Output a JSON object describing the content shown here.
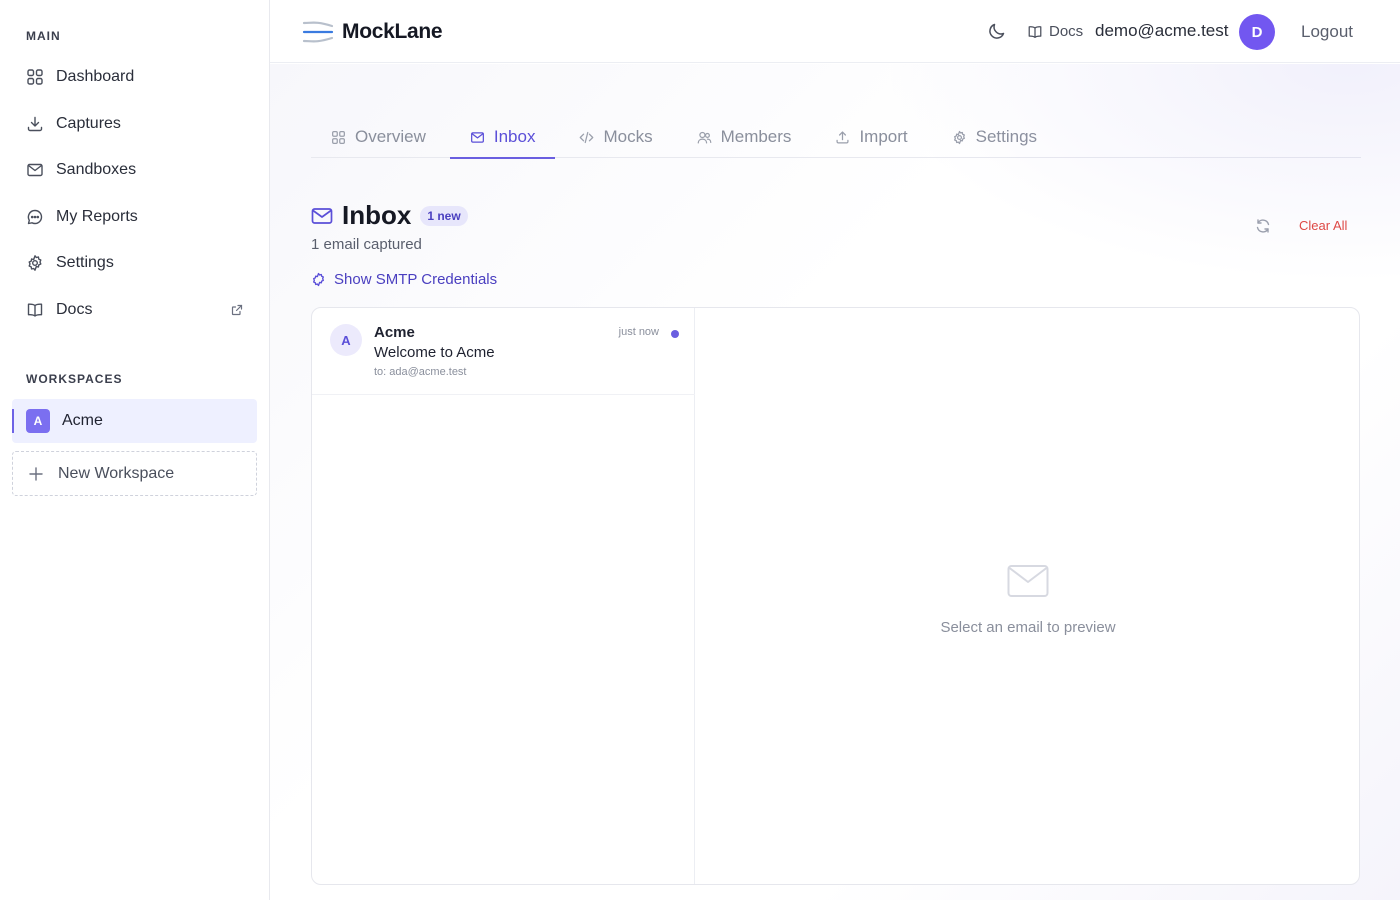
{
  "sidebar": {
    "main_label": "MAIN",
    "items": [
      {
        "label": "Dashboard",
        "icon": "grid-icon"
      },
      {
        "label": "Captures",
        "icon": "download-icon"
      },
      {
        "label": "Sandboxes",
        "icon": "mail-icon"
      },
      {
        "label": "My Reports",
        "icon": "chat-icon"
      },
      {
        "label": "Settings",
        "icon": "gear-icon"
      },
      {
        "label": "Docs",
        "icon": "book-icon",
        "external": true
      }
    ],
    "workspaces_label": "WORKSPACES",
    "workspaces": [
      {
        "initial": "A",
        "name": "Acme",
        "active": true
      }
    ],
    "new_workspace_label": "New Workspace"
  },
  "header": {
    "brand": "MockLane",
    "docs_label": "Docs",
    "user_email": "demo@acme.test",
    "avatar_initial": "D",
    "logout_label": "Logout"
  },
  "tabs": [
    {
      "label": "Overview",
      "icon": "grid-icon",
      "active": false
    },
    {
      "label": "Inbox",
      "icon": "mail-icon",
      "active": true
    },
    {
      "label": "Mocks",
      "icon": "code-icon",
      "active": false
    },
    {
      "label": "Members",
      "icon": "users-icon",
      "active": false
    },
    {
      "label": "Import",
      "icon": "upload-icon",
      "active": false
    },
    {
      "label": "Settings",
      "icon": "gear-icon",
      "active": false
    }
  ],
  "inbox": {
    "title": "Inbox",
    "badge": "1 new",
    "subtitle": "1 email captured",
    "smtp_label": "Show SMTP Credentials",
    "clear_all_label": "Clear All",
    "emails": [
      {
        "initial": "A",
        "from": "Acme",
        "subject": "Welcome to Acme",
        "to": "to: ada@acme.test",
        "time": "just now",
        "unread": true
      }
    ],
    "empty_preview_text": "Select an email to preview"
  },
  "colors": {
    "accent": "#6a5ee0",
    "danger": "#e0443e",
    "avatar": "#7257f0"
  }
}
